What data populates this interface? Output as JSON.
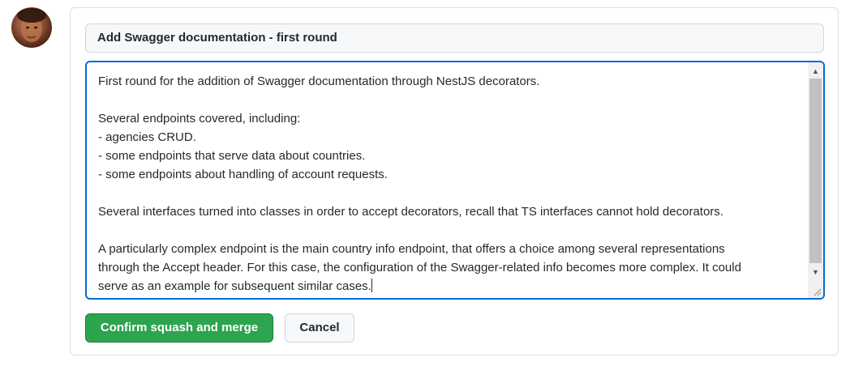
{
  "avatar": {
    "icon": "user-avatar-photo"
  },
  "merge_form": {
    "commit_title": "Add Swagger documentation - first round",
    "commit_body_lines": [
      "First round for the addition of Swagger documentation through NestJS decorators.",
      "",
      "Several endpoints covered, including:",
      "- agencies CRUD.",
      "- some endpoints that serve data about countries.",
      "- some endpoints about handling of account requests.",
      "",
      "Several interfaces turned into classes in order to accept decorators, recall that TS interfaces cannot hold decorators.",
      "",
      "A particularly complex endpoint is the main country info endpoint, that offers a choice among several representations",
      "through the Accept header. For this case, the configuration of the Swagger-related info becomes more complex. It could",
      "serve as an example for subsequent similar cases."
    ],
    "confirm_label": "Confirm squash and merge",
    "cancel_label": "Cancel"
  },
  "colors": {
    "primary_button": "#2da44e",
    "focus_border": "#0969da",
    "input_background": "#f6f8fa"
  }
}
